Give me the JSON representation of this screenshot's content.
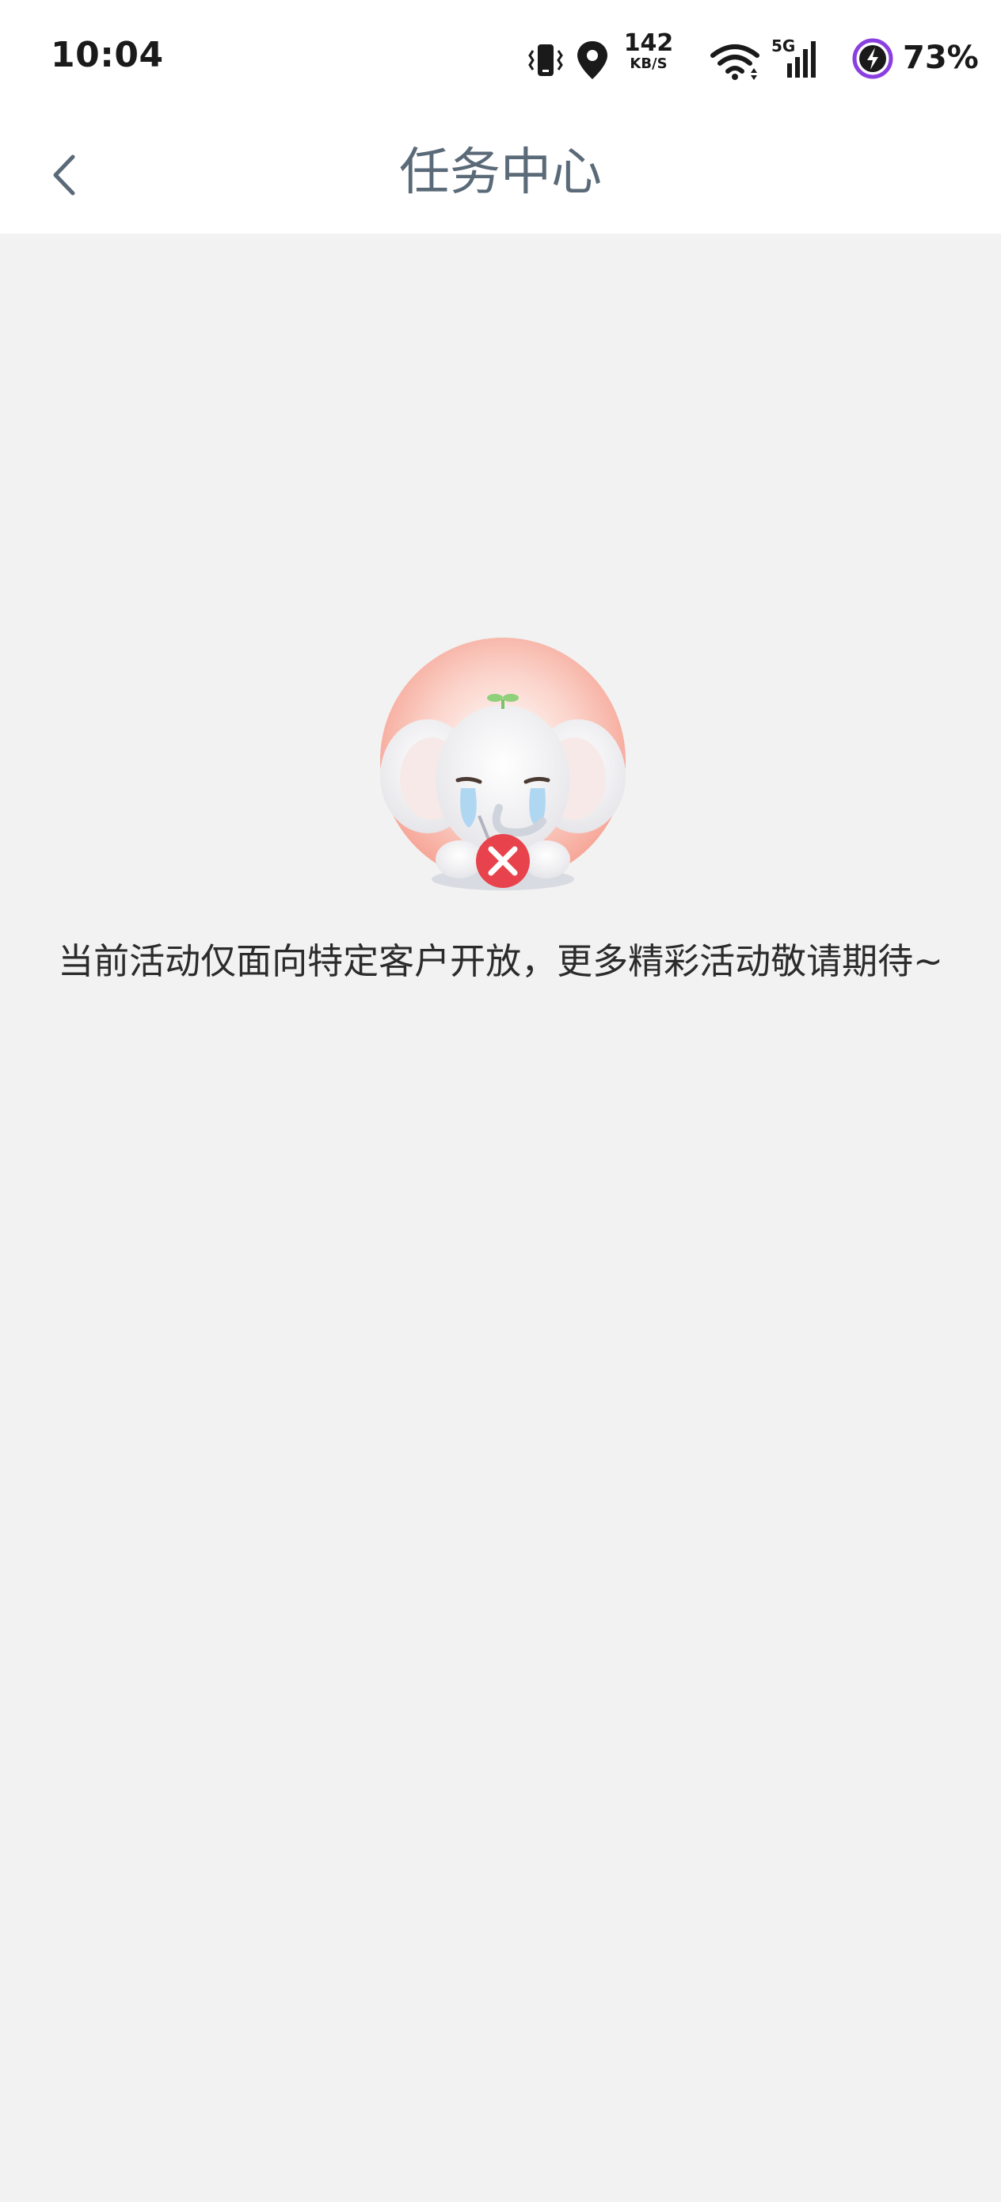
{
  "status_bar": {
    "time": "10:04",
    "net_speed_value": "142",
    "net_speed_unit": "KB/S",
    "network_type": "5G",
    "battery_percent": "73%",
    "icons": [
      "vibrate-icon",
      "location-icon",
      "wifi-icon",
      "signal-icon",
      "battery-charging-icon"
    ]
  },
  "nav": {
    "back_icon": "chevron-left-icon",
    "title": "任务中心"
  },
  "empty_state": {
    "illustration": "crying-elephant-mascot-with-x-badge",
    "message": "当前活动仅面向特定客户开放，更多精彩活动敬请期待~"
  },
  "colors": {
    "background": "#f2f2f2",
    "header_bg": "#ffffff",
    "title_color": "#5a6a78",
    "message_color": "#2b2b2b",
    "error_red": "#e8434c",
    "battery_ring": "#8a3fe0"
  }
}
